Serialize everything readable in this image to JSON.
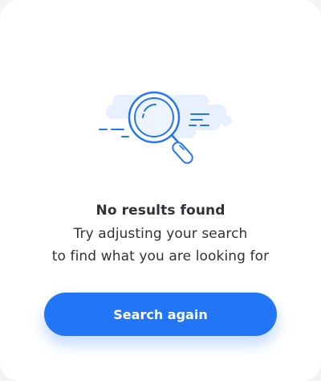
{
  "empty_state": {
    "icon": "magnifier-search-icon",
    "title": "No results found",
    "message_line1": "Try adjusting your search",
    "message_line2": "to find what you are looking for"
  },
  "actions": {
    "search_again_label": "Search again"
  },
  "colors": {
    "accent": "#2276f6",
    "illustration_light": "#e8f0fd",
    "text": "#2f3338",
    "background": "#ffffff"
  }
}
